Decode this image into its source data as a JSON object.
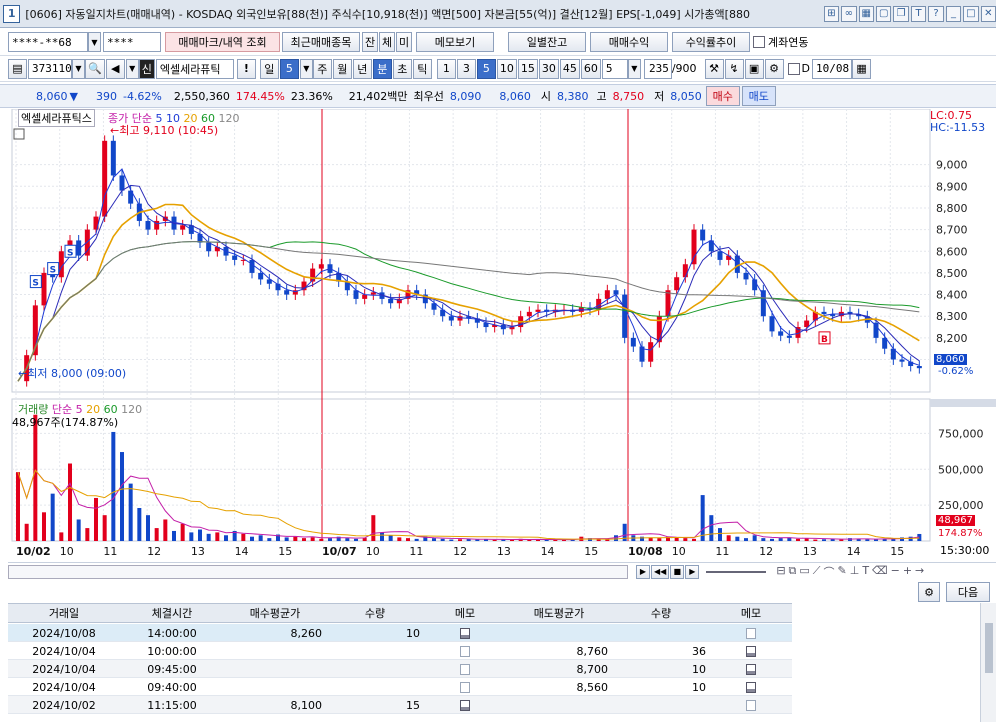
{
  "window": {
    "num": "1",
    "title": "[0606] 자동일지차트(매매내역) - KOSDAQ 외국인보유[88(천)] 주식수[10,918(천)] 액면[500] 자본금[55(억)] 결산[12월] EPS[-1,049] 시가총액[880"
  },
  "toolbar1": {
    "account": "****-**68",
    "password": "****",
    "btn_mark": "매매마크/내역 조회",
    "btn_recent": "최근매매종목",
    "btn_jan": "잔",
    "btn_che": "체",
    "btn_mi": "미",
    "btn_memo": "메모보기",
    "btn_daily": "일별잔고",
    "btn_profit": "매매수익",
    "btn_trend": "수익률추이",
    "chk_link": "계좌연동"
  },
  "toolbar2": {
    "code": "373110",
    "shin": "신",
    "stock_name": "엑셀세라퓨틱",
    "excl": "!",
    "il": "일",
    "il_val": "5",
    "ju": "주",
    "wol": "월",
    "nyeon": "년",
    "bun": "분",
    "cho": "초",
    "tik": "틱",
    "periods": [
      "1",
      "3",
      "5",
      "10",
      "15",
      "30",
      "45",
      "60"
    ],
    "sel_period": "5",
    "count": "5",
    "ratio": "235",
    "ratio_total": "/900",
    "date": "10/08",
    "d_label": "D"
  },
  "quote": {
    "price": "8,060",
    "change": "390",
    "change_pct": "-4.62%",
    "volume": "2,550,360",
    "vol_pct": "174.45%",
    "turnover": "23.36%",
    "amount": "21,402백만",
    "best_label": "최우선",
    "best_ask": "8,090",
    "best_bid": "8,060",
    "open_label": "시",
    "open": "8,380",
    "high_label": "고",
    "high": "8,750",
    "low_label": "저",
    "low": "8,050",
    "buy": "매수",
    "sell": "매도"
  },
  "chart_data": {
    "type": "candlestick",
    "stock_label": "엑셀세라퓨틱스",
    "ma_legend": {
      "name": "종가 단순",
      "periods": [
        "5",
        "10",
        "20",
        "60",
        "120"
      ],
      "colors": [
        "#1f3bd6",
        "#1f3bd6",
        "#e6a100",
        "#1a9a2a",
        "#777777"
      ]
    },
    "lc": "LC:0.75",
    "hc": "HC:-11.53",
    "ylim": [
      7950,
      9220
    ],
    "y_ticks": [
      "9,000",
      "8,900",
      "8,800",
      "8,700",
      "8,600",
      "8,500",
      "8,400",
      "8,300",
      "8,200",
      "8,100"
    ],
    "y_tick_values": [
      9000,
      8900,
      8800,
      8700,
      8600,
      8500,
      8400,
      8300,
      8200,
      8100
    ],
    "current_price": "8,060",
    "current_pct": "-0.62%",
    "annot_high": "최고 9,110 (10:45)",
    "annot_low": "최저 8,000 (09:00)",
    "markers": [
      "S",
      "S",
      "S",
      "B"
    ],
    "x_labels": [
      "10/02",
      "10",
      "11",
      "12",
      "13",
      "14",
      "15",
      "10/07",
      "10",
      "11",
      "12",
      "13",
      "14",
      "15",
      "10/08",
      "10",
      "11",
      "12",
      "13",
      "14",
      "15"
    ],
    "time_right": "15:30:00",
    "price_path": [
      8000,
      8120,
      8350,
      8500,
      8480,
      8600,
      8650,
      8580,
      8700,
      8760,
      9110,
      8950,
      8880,
      8820,
      8740,
      8700,
      8740,
      8760,
      8700,
      8720,
      8680,
      8640,
      8600,
      8620,
      8580,
      8560,
      8560,
      8500,
      8470,
      8450,
      8420,
      8400,
      8420,
      8460,
      8520,
      8540,
      8500,
      8460,
      8420,
      8380,
      8400,
      8410,
      8380,
      8360,
      8380,
      8420,
      8400,
      8360,
      8330,
      8300,
      8280,
      8300,
      8290,
      8270,
      8250,
      8260,
      8240,
      8250,
      8300,
      8320,
      8330,
      8320,
      8330,
      8330,
      8320,
      8340,
      8330,
      8380,
      8420,
      8400,
      8200,
      8160,
      8090,
      8180,
      8300,
      8420,
      8480,
      8540,
      8700,
      8650,
      8600,
      8560,
      8580,
      8500,
      8470,
      8420,
      8300,
      8230,
      8210,
      8200,
      8250,
      8280,
      8320,
      8310,
      8300,
      8320,
      8310,
      8300,
      8270,
      8200,
      8150,
      8100,
      8090,
      8070,
      8060
    ],
    "volume": {
      "label": "거래량",
      "ma_name": "단순",
      "ma_periods": [
        "5",
        "20",
        "60",
        "120"
      ],
      "note": "48,967주(174.87%)",
      "y_ticks": [
        "750,000",
        "500,000",
        "250,000"
      ],
      "y_tick_values": [
        750000,
        500000,
        250000
      ],
      "ylim": [
        0,
        920000
      ],
      "current": "48,967",
      "current_pct": "174.87%",
      "values": [
        480000,
        120000,
        880000,
        200000,
        330000,
        60000,
        540000,
        150000,
        90000,
        300000,
        180000,
        760000,
        620000,
        400000,
        230000,
        180000,
        90000,
        150000,
        70000,
        120000,
        60000,
        80000,
        50000,
        60000,
        40000,
        70000,
        50000,
        30000,
        40000,
        20000,
        45000,
        25000,
        30000,
        20000,
        25000,
        15000,
        20000,
        30000,
        20000,
        15000,
        22000,
        180000,
        60000,
        40000,
        25000,
        20000,
        15000,
        30000,
        20000,
        15000,
        10000,
        12000,
        15000,
        10000,
        12000,
        8000,
        10000,
        12000,
        15000,
        8000,
        10000,
        9000,
        12000,
        10000,
        8000,
        30000,
        20000,
        15000,
        12000,
        40000,
        120000,
        40000,
        30000,
        25000,
        20000,
        30000,
        25000,
        20000,
        15000,
        320000,
        180000,
        90000,
        40000,
        30000,
        20000,
        40000,
        20000,
        15000,
        20000,
        25000,
        15000,
        20000,
        10000,
        12000,
        15000,
        10000,
        20000,
        15000,
        12000,
        10000,
        15000,
        20000,
        25000,
        30000,
        48967
      ]
    }
  },
  "grid": {
    "headers": [
      "거래일",
      "체결시간",
      "매수평균가",
      "수량",
      "메모",
      "매도평균가",
      "수량",
      "메모"
    ],
    "rows": [
      {
        "date": "2024/10/08",
        "time": "14:00:00",
        "buy_avg": "8,260",
        "buy_qty": "10",
        "sell_avg": "",
        "sell_qty": "",
        "memo1": true,
        "memo2": false
      },
      {
        "date": "2024/10/04",
        "time": "10:00:00",
        "buy_avg": "",
        "buy_qty": "",
        "sell_avg": "8,760",
        "sell_qty": "36",
        "memo1": false,
        "memo2": true
      },
      {
        "date": "2024/10/04",
        "time": "09:45:00",
        "buy_avg": "",
        "buy_qty": "",
        "sell_avg": "8,700",
        "sell_qty": "10",
        "memo1": false,
        "memo2": true
      },
      {
        "date": "2024/10/04",
        "time": "09:40:00",
        "buy_avg": "",
        "buy_qty": "",
        "sell_avg": "8,560",
        "sell_qty": "10",
        "memo1": false,
        "memo2": true
      },
      {
        "date": "2024/10/02",
        "time": "11:15:00",
        "buy_avg": "8,100",
        "buy_qty": "15",
        "sell_avg": "",
        "sell_qty": "",
        "memo1": true,
        "memo2": false
      }
    ],
    "next_btn": "다음"
  },
  "colors": {
    "up": "#e2001c",
    "down": "#1147c9",
    "selected_row": "#dcecf7",
    "accent": "#3b6ec9"
  }
}
